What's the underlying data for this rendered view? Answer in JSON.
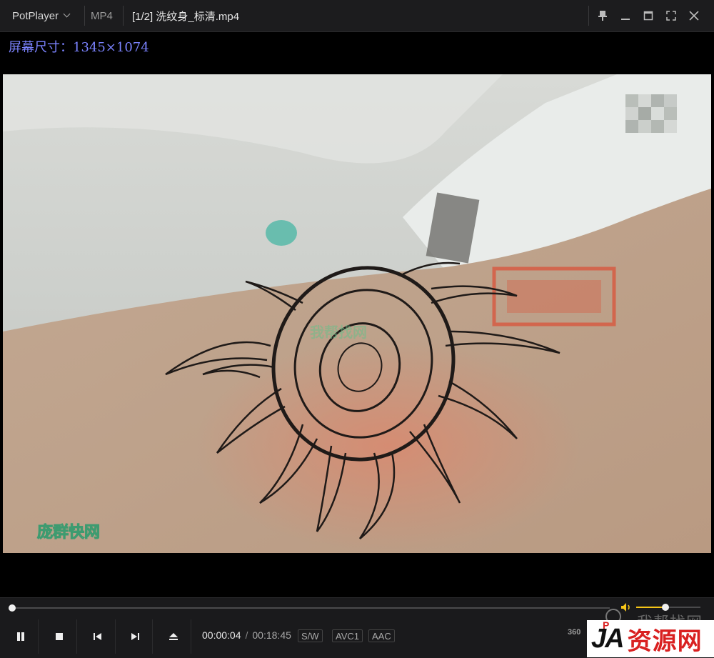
{
  "titlebar": {
    "app_name": "PotPlayer",
    "format": "MP4",
    "file_title": "[1/2] 洗纹身_标清.mp4",
    "buttons": [
      "pin-icon",
      "minimize-icon",
      "maximize-icon",
      "fullscreen-icon",
      "close-icon"
    ]
  },
  "overlay": {
    "screen_size_text": "屏幕尺寸：1345×1074"
  },
  "video": {
    "watermark_bottom": "庞群快网",
    "watermark_center": "我帮找网",
    "top_right_mosaic": true
  },
  "playback": {
    "progress": 0.004,
    "current_time": "00:00:04",
    "separator": "/",
    "total_time": "00:18:45",
    "tags": [
      "S/W",
      "AVC1",
      "AAC"
    ],
    "vr_label": "360",
    "volume": 0.45,
    "colors": {
      "volume": "#f5c518",
      "overlay": "#7b83ff"
    }
  },
  "brand_overlay": {
    "search_text": "我帮找网",
    "logo_ja": "JA",
    "logo_sup": "P",
    "logo_cn": "资源网"
  }
}
